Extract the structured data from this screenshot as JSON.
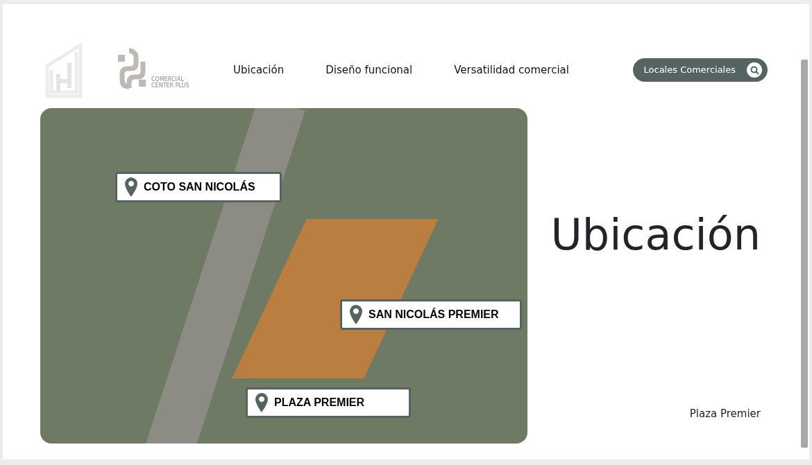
{
  "logo": {
    "tagline": "COMERCIAL CENTER PLUS"
  },
  "nav": [
    {
      "label": "Ubicación"
    },
    {
      "label": "Diseño funcional"
    },
    {
      "label": "Versatilidad comercial"
    }
  ],
  "search_button": {
    "label": "Locales Comerciales"
  },
  "map": {
    "labels": [
      {
        "text": "COTO SAN NICOLÁS"
      },
      {
        "text": "SAN NICOLÁS PREMIER"
      },
      {
        "text": "PLAZA PREMIER"
      }
    ]
  },
  "heading": "Ubicación",
  "caption": "Plaza Premier"
}
